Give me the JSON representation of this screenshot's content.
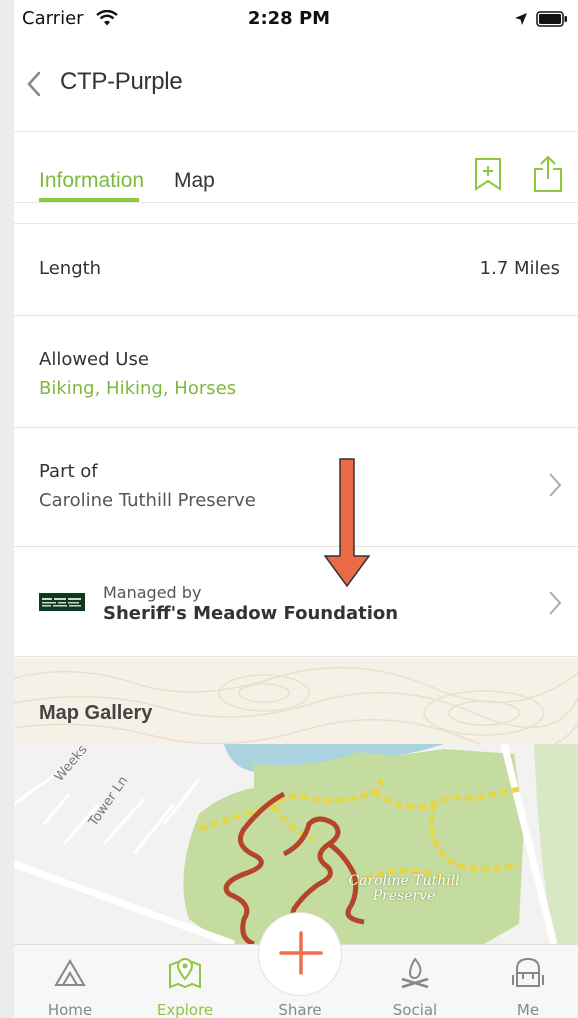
{
  "status_bar": {
    "carrier": "Carrier",
    "time": "2:28 PM"
  },
  "nav": {
    "title": "CTP-Purple",
    "back_icon": "chevron-left-icon"
  },
  "tabs": {
    "information": "Information",
    "map": "Map",
    "active": "Information"
  },
  "details": {
    "length": {
      "label": "Length",
      "value": "1.7 Miles"
    },
    "allowed_use": {
      "label": "Allowed Use",
      "value": "Biking, Hiking, Horses"
    },
    "part_of": {
      "label": "Part of",
      "value": "Caroline Tuthill Preserve"
    },
    "managed_by": {
      "label": "Managed by",
      "value": "Sheriff's Meadow Foundation"
    }
  },
  "gallery": {
    "title": "Map Gallery",
    "map_labels": {
      "preserve_line1": "Caroline Tuthill",
      "preserve_line2": "Preserve",
      "street1": "Weeks",
      "street2": "Tower Ln"
    }
  },
  "bottom_tabs": [
    {
      "label": "Home",
      "icon": "mountain-icon"
    },
    {
      "label": "Explore",
      "icon": "map-pin-icon"
    },
    {
      "label": "Share",
      "icon": "plus-icon"
    },
    {
      "label": "Social",
      "icon": "campfire-icon"
    },
    {
      "label": "Me",
      "icon": "backpack-icon"
    }
  ],
  "colors": {
    "accent_green": "#8dc63f",
    "text_green": "#7cba3d",
    "arrow": "#e86a47",
    "plus": "#ee6f4b"
  }
}
